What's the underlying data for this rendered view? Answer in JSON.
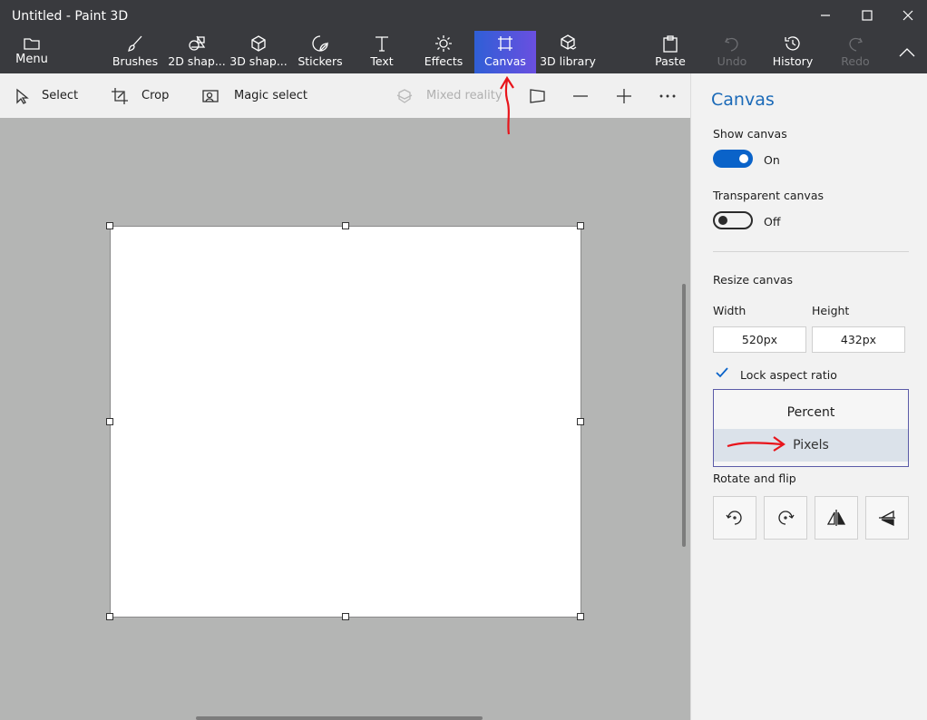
{
  "window": {
    "title": "Untitled - Paint 3D"
  },
  "ribbon": {
    "menu": "Menu",
    "brushes": "Brushes",
    "shapes2d": "2D shap...",
    "shapes3d": "3D shap...",
    "stickers": "Stickers",
    "text": "Text",
    "effects": "Effects",
    "canvas": "Canvas",
    "library3d": "3D library",
    "paste": "Paste",
    "undo": "Undo",
    "history": "History",
    "redo": "Redo"
  },
  "toolbar": {
    "select": "Select",
    "crop": "Crop",
    "magic_select": "Magic select",
    "mixed_reality": "Mixed reality"
  },
  "panel": {
    "title": "Canvas",
    "show_canvas": {
      "label": "Show canvas",
      "state": "On",
      "on": true
    },
    "transparent_canvas": {
      "label": "Transparent canvas",
      "state": "Off",
      "on": false
    },
    "resize_label": "Resize canvas",
    "width_label": "Width",
    "height_label": "Height",
    "width_value": "520px",
    "height_value": "432px",
    "lock_aspect": {
      "label": "Lock aspect ratio",
      "checked": true
    },
    "units": {
      "options": [
        "Percent",
        "Pixels"
      ],
      "selected": "Pixels"
    },
    "rotate_label": "Rotate and flip"
  },
  "colors": {
    "accent": "#0a63c9",
    "title_accent": "#1b6ab8",
    "ribbon_bg": "#393a3e",
    "annotation": "#e8141b"
  }
}
